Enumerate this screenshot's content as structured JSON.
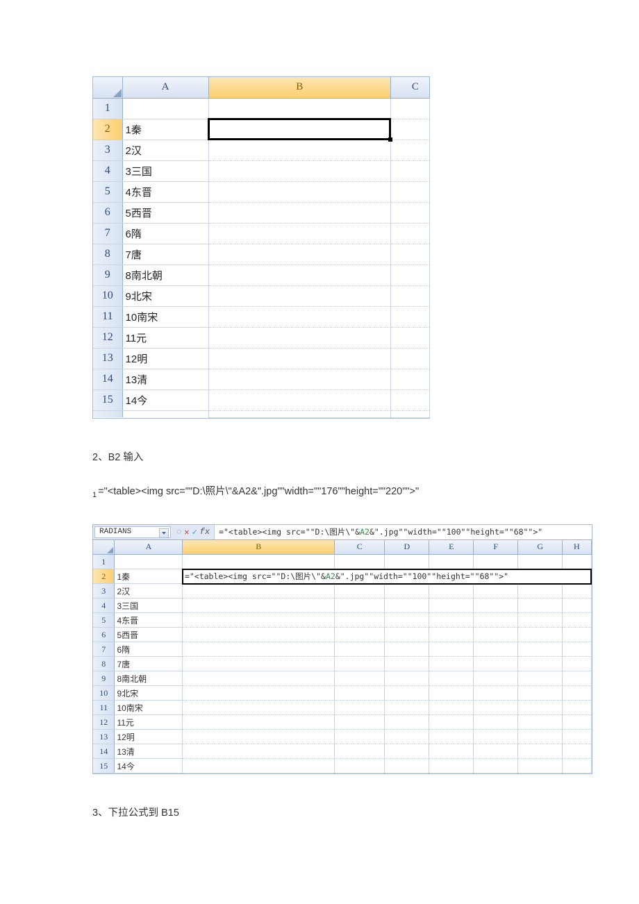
{
  "sheet1": {
    "columns": [
      "A",
      "B",
      "C"
    ],
    "selected_cell": "B2",
    "selected_row": 2,
    "selected_col": "B",
    "rows": [
      {
        "n": 1,
        "A": ""
      },
      {
        "n": 2,
        "A": "1秦"
      },
      {
        "n": 3,
        "A": "2汉"
      },
      {
        "n": 4,
        "A": "3三国"
      },
      {
        "n": 5,
        "A": "4东晋"
      },
      {
        "n": 6,
        "A": "5西晋"
      },
      {
        "n": 7,
        "A": "6隋"
      },
      {
        "n": 8,
        "A": "7唐"
      },
      {
        "n": 9,
        "A": "8南北朝"
      },
      {
        "n": 10,
        "A": "9北宋"
      },
      {
        "n": 11,
        "A": "10南宋"
      },
      {
        "n": 12,
        "A": "11元"
      },
      {
        "n": 13,
        "A": "12明"
      },
      {
        "n": 14,
        "A": "13清"
      },
      {
        "n": 15,
        "A": "14今"
      }
    ],
    "c_partial": "C"
  },
  "step2_label": "2、B2 输入",
  "code_prefix": "1",
  "code_line": "=\"<table><img src=\"\"D:\\照片\\\"&A2&\".jpg\"\"width=\"\"176\"\"height=\"\"220\"\">\"",
  "sheet2": {
    "namebox": "RADIANS",
    "formula_plain": "=\"<table><img src=\"\"D:\\图片\\\"&A2&\".jpg\"\"width=\"\"100\"\"height=\"\"68\"\">\"",
    "formula_pre": "=\"<table><img src=\"\"D:\\图片\\\"&",
    "formula_ref": "A2",
    "formula_post": "&\".jpg\"\"width=\"\"100\"\"height=\"\"68\"\">\"",
    "columns": [
      "A",
      "B",
      "C",
      "D",
      "E",
      "F",
      "G",
      "H"
    ],
    "selected_row": 2,
    "selected_col": "B",
    "rows": [
      {
        "n": 1,
        "A": ""
      },
      {
        "n": 2,
        "A": "1秦"
      },
      {
        "n": 3,
        "A": "2汉"
      },
      {
        "n": 4,
        "A": "3三国"
      },
      {
        "n": 5,
        "A": "4东晋"
      },
      {
        "n": 6,
        "A": "5西晋"
      },
      {
        "n": 7,
        "A": "6隋"
      },
      {
        "n": 8,
        "A": "7唐"
      },
      {
        "n": 9,
        "A": "8南北朝"
      },
      {
        "n": 10,
        "A": "9北宋"
      },
      {
        "n": 11,
        "A": "10南宋"
      },
      {
        "n": 12,
        "A": "11元"
      },
      {
        "n": 13,
        "A": "12明"
      },
      {
        "n": 14,
        "A": "13清"
      },
      {
        "n": 15,
        "A": "14今"
      }
    ]
  },
  "step3_label": "3、下拉公式到 B15"
}
